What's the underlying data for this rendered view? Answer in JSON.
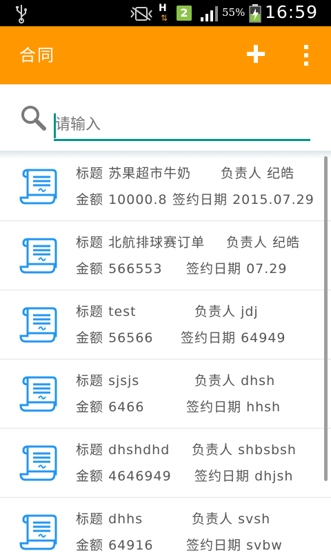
{
  "status_bar": {
    "network_type": "H",
    "sim_slot": "2",
    "battery_percent": "55%",
    "clock": "16:59"
  },
  "app_bar": {
    "title": "合同",
    "add_icon": "plus-icon",
    "more_icon": "overflow-menu-icon"
  },
  "search": {
    "placeholder": "请输入",
    "value": "",
    "icon": "search-icon"
  },
  "contracts": [
    {
      "title_label": "标题",
      "title": "苏果超市牛奶",
      "owner_label": "负责人",
      "owner": "纪皓",
      "amount_label": "金额",
      "amount": "10000.8",
      "date_label": "签约日期",
      "date": "2015.07.29"
    },
    {
      "title_label": "标题",
      "title": "北航排球赛订单",
      "owner_label": "负责人",
      "owner": "纪皓",
      "amount_label": "金额",
      "amount": "566553",
      "date_label": "签约日期",
      "date": "07.29"
    },
    {
      "title_label": "标题",
      "title": "test",
      "owner_label": "负责人",
      "owner": "jdj",
      "amount_label": "金额",
      "amount": "56566",
      "date_label": "签约日期",
      "date": "64949"
    },
    {
      "title_label": "标题",
      "title": "sjsjs",
      "owner_label": "负责人",
      "owner": "dhsh",
      "amount_label": "金额",
      "amount": "6466",
      "date_label": "签约日期",
      "date": "hhsh"
    },
    {
      "title_label": "标题",
      "title": "dhshdhd",
      "owner_label": "负责人",
      "owner": "shbsbsh",
      "amount_label": "金额",
      "amount": "4646949",
      "date_label": "签约日期",
      "date": "dhjsh"
    },
    {
      "title_label": "标题",
      "title": "dhhs",
      "owner_label": "负责人",
      "owner": "svsh",
      "amount_label": "金额",
      "amount": "64916",
      "date_label": "签约日期",
      "date": "svbw"
    }
  ],
  "colors": {
    "app_bar": "#ff9800",
    "accent": "#009688",
    "icon_blue": "#2196f3",
    "text": "#555555"
  }
}
